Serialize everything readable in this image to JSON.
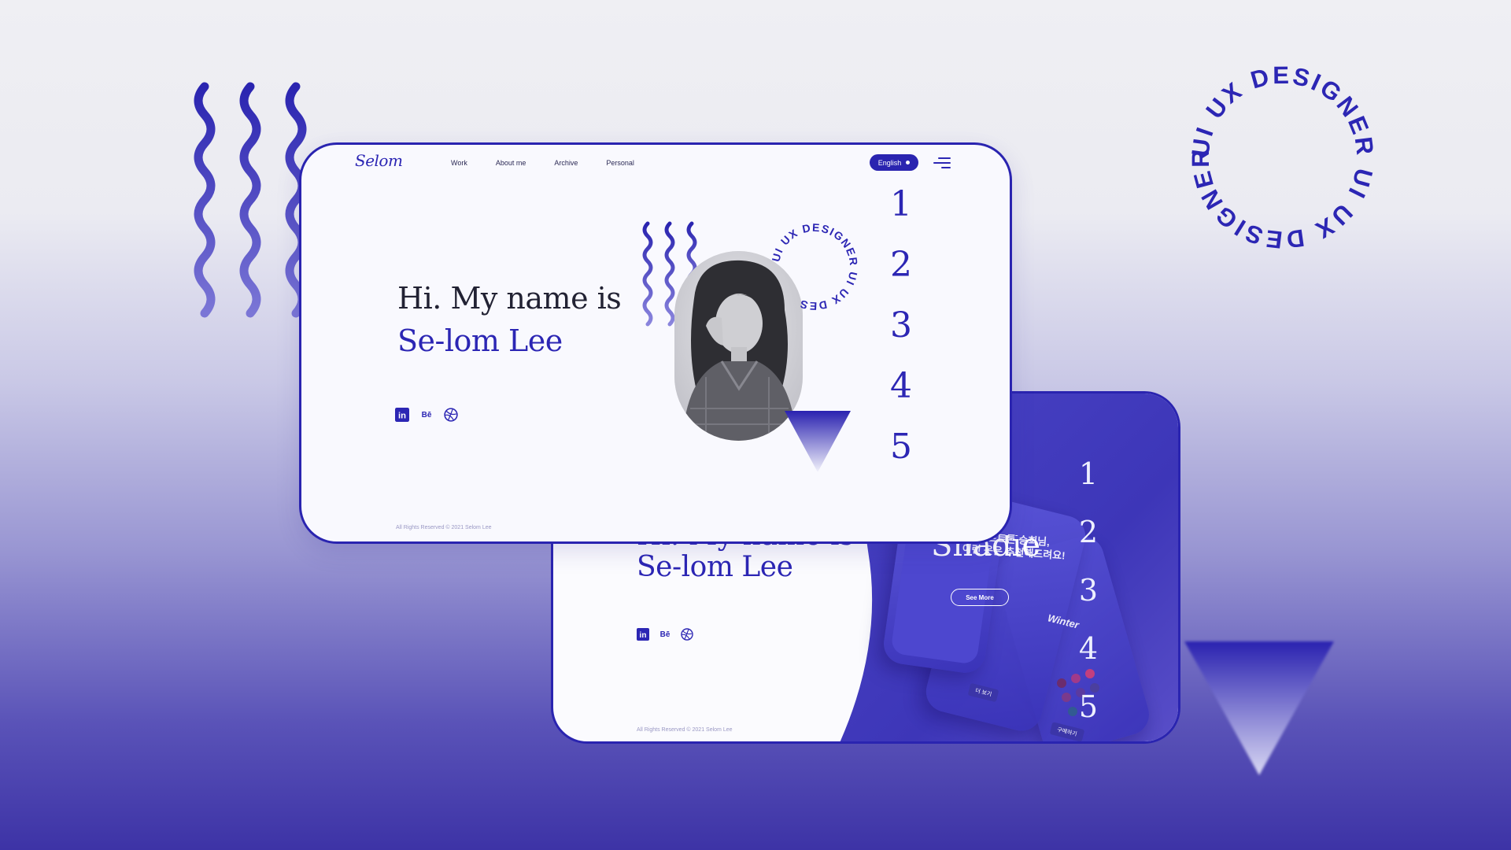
{
  "background": {
    "ring_text": "UI UX DESIGNER UI UX DESIGNER "
  },
  "front": {
    "logo": "Selom",
    "nav": [
      "Work",
      "About me",
      "Archive",
      "Personal"
    ],
    "language_button": "English",
    "greeting": "Hi. My name is",
    "name": "Se-lom Lee",
    "social": {
      "linkedin": "in",
      "behance": "Bē",
      "dribbble": "dribbble"
    },
    "footer": "All Rights Reserved © 2021 Selom Lee",
    "ring_text": "UI UX DESIGNER UI UX DES",
    "page_numbers": [
      "1",
      "2",
      "3",
      "4",
      "5"
    ]
  },
  "back": {
    "name": "Se-lom Lee",
    "project_title": "Shadie",
    "see_more": "See More",
    "korean_line1": "■■ 소프트톤 승희님,",
    "korean_line2": "이런 옷은 추천해드려요!",
    "winter_label": "Winter",
    "button_small_1": "더 보기",
    "button_small_2": "구매하기",
    "footer": "All Rights Reserved © 2021 Selom Lee",
    "page_numbers": [
      "1",
      "2",
      "3",
      "4",
      "5"
    ]
  },
  "colors": {
    "accent": "#2c26b4",
    "card_border": "#2a24b0",
    "card_bg": "#f9f9fe",
    "gradient_bottom": "#3d33a6"
  }
}
